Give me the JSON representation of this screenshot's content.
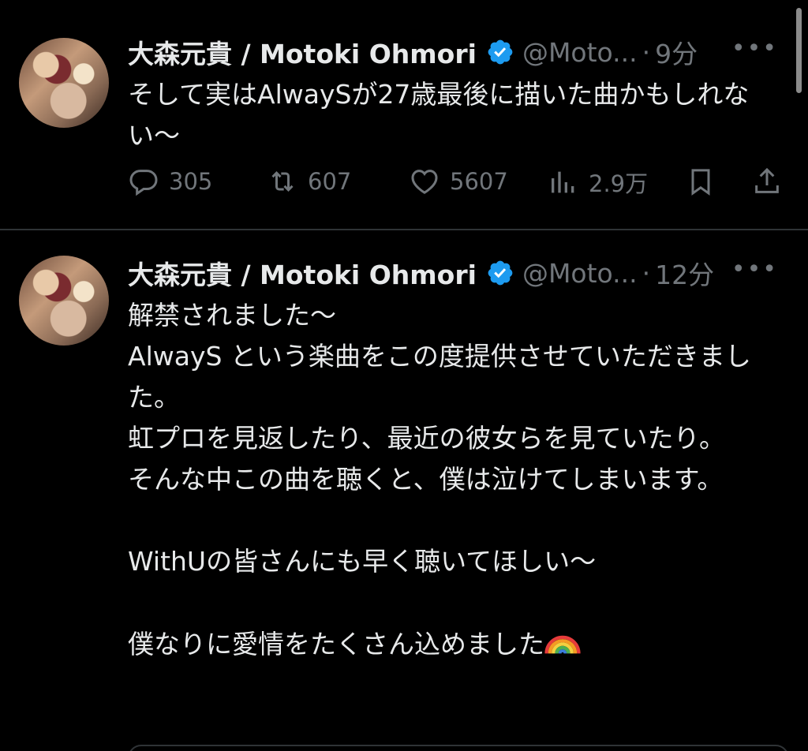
{
  "tweets": [
    {
      "display_name": "大森元貴 / Motoki Ohmori",
      "handle": "@Moto...",
      "separator": "·",
      "time": "9分",
      "text": "そして実はAlwaySが27歳最後に描いた曲かもしれない〜",
      "replies": "305",
      "retweets": "607",
      "likes": "5607",
      "views": "2.9万"
    },
    {
      "display_name": "大森元貴 / Motoki Ohmori",
      "handle": "@Moto...",
      "separator": "·",
      "time": "12分",
      "text": "解禁されました〜\nAlwayS という楽曲をこの度提供させていただきました。\n虹プロを見返したり、最近の彼女らを見ていたり。\nそんな中この曲を聴くと、僕は泣けてしまいます。\n\nWithUの皆さんにも早く聴いてほしい〜\n\n僕なりに愛情をたくさん込めました"
    }
  ],
  "colors": {
    "background": "#000000",
    "text": "#e7e9ea",
    "muted": "#71767b",
    "verified": "#1d9bf0",
    "divider": "#2f3336"
  },
  "icons": {
    "verified": "verified-badge-icon",
    "more": "more-options-icon",
    "reply": "reply-icon",
    "retweet": "retweet-icon",
    "like": "heart-icon",
    "views": "views-chart-icon",
    "bookmark": "bookmark-icon",
    "share": "share-icon",
    "emoji": "rainbow-emoji"
  }
}
